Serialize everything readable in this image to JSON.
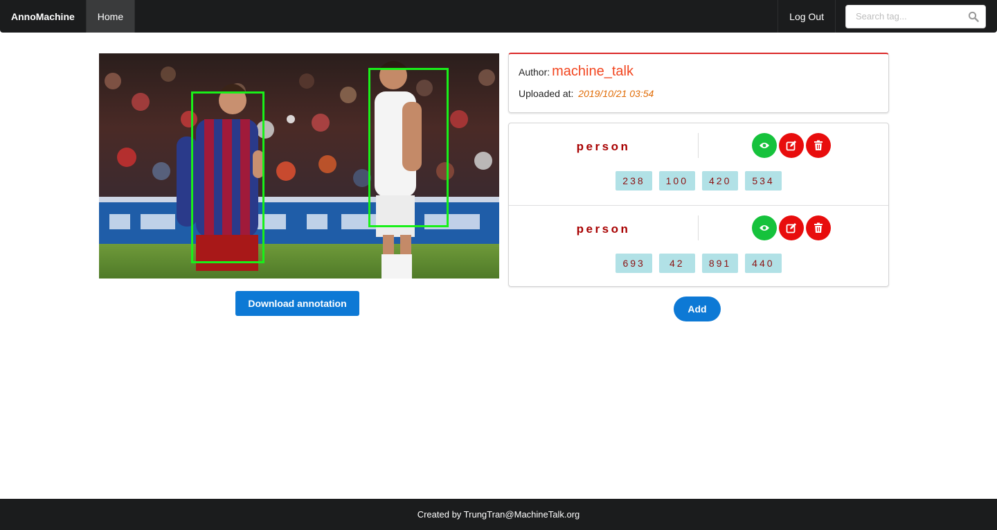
{
  "navbar": {
    "brand": "AnnoMachine",
    "home_label": "Home",
    "logout_label": "Log Out",
    "search_placeholder": "Search tag..."
  },
  "image": {
    "box_color": "#19f019"
  },
  "download_label": "Download annotation",
  "author_card": {
    "author_label": "Author:",
    "author_name": "machine_talk",
    "uploaded_label": "Uploaded at:",
    "uploaded_value": "2019/10/21 03:54"
  },
  "annotations": [
    {
      "label": "person",
      "coords": [
        "238",
        "100",
        "420",
        "534"
      ],
      "actions": [
        "eye-icon",
        "edit-icon",
        "trash-icon"
      ]
    },
    {
      "label": "person",
      "coords": [
        "693",
        "42",
        "891",
        "440"
      ],
      "actions": [
        "eye-icon",
        "edit-icon",
        "trash-icon"
      ]
    }
  ],
  "add_label": "Add",
  "footer_text": "Created by TrungTran@MachineTalk.org",
  "colors": {
    "primary": "#0d79d5",
    "view": "#16c23c",
    "danger": "#e80d0d",
    "label": "#a80000",
    "author": "#f2451f",
    "timestamp": "#e06b05"
  }
}
